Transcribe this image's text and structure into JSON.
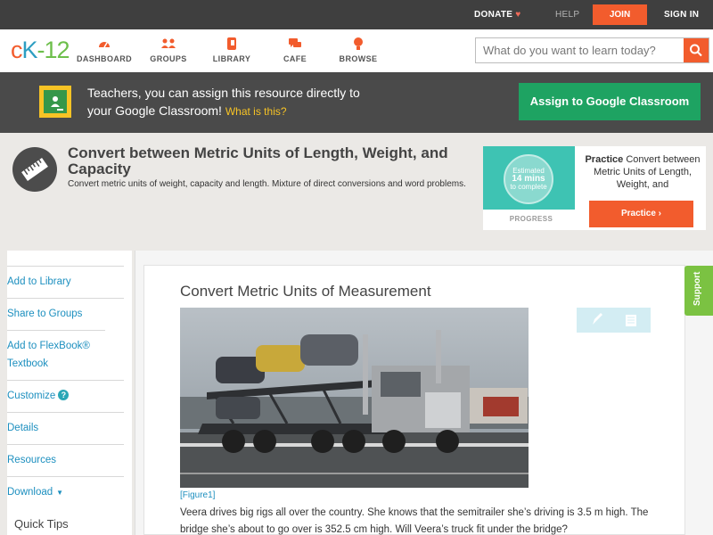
{
  "topbar": {
    "donate": "DONATE",
    "help": "HELP",
    "join": "JOIN",
    "signin": "SIGN IN"
  },
  "logo": {
    "c": "c",
    "k": "K",
    "dash": "-",
    "num": "12"
  },
  "nav": {
    "items": [
      {
        "label": "DASHBOARD",
        "icon": "dashboard-icon"
      },
      {
        "label": "GROUPS",
        "icon": "groups-icon"
      },
      {
        "label": "LIBRARY",
        "icon": "library-icon"
      },
      {
        "label": "CAFE",
        "icon": "cafe-icon"
      },
      {
        "label": "BROWSE",
        "icon": "browse-icon"
      }
    ],
    "search_placeholder": "What do you want to learn today?"
  },
  "classroom": {
    "line1": "Teachers, you can assign this resource directly to",
    "line2": "your Google Classroom!",
    "what": "What is this?",
    "button": "Assign to Google Classroom"
  },
  "concept": {
    "title": "Convert between Metric Units of Length, Weight, and Capacity",
    "description": "Convert metric units of weight, capacity and length. Mixture of direct conversions and word problems."
  },
  "practice": {
    "estimated": "Estimated",
    "mins": "14 mins",
    "to_complete": "to complete",
    "progress": "PROGRESS",
    "label_bold": "Practice",
    "label_rest": "Convert between Metric Units of Length, Weight, and",
    "button": "Practice"
  },
  "sidebar": {
    "items": [
      {
        "label": "Add to Library"
      },
      {
        "label": "Share to Groups"
      },
      {
        "label": "Add to FlexBook® Textbook"
      },
      {
        "label": "Customize"
      },
      {
        "label": "Details"
      },
      {
        "label": "Resources"
      },
      {
        "label": "Download"
      }
    ],
    "customize_badge": "?",
    "quick_tips": "Quick Tips"
  },
  "article": {
    "title": "Convert Metric Units of Measurement",
    "figure_caption": "[Figure1]",
    "body": "Veera drives big rigs all over the country. She knows that the semitrailer she’s driving is 3.5 m high. The bridge she’s about to go over is 352.5 cm high. Will Veera’s truck fit under the bridge?"
  },
  "support": "Support",
  "colors": {
    "accent": "#f25c2d",
    "google_green": "#1ea362",
    "link": "#1c8fbf",
    "support": "#7bc242"
  }
}
